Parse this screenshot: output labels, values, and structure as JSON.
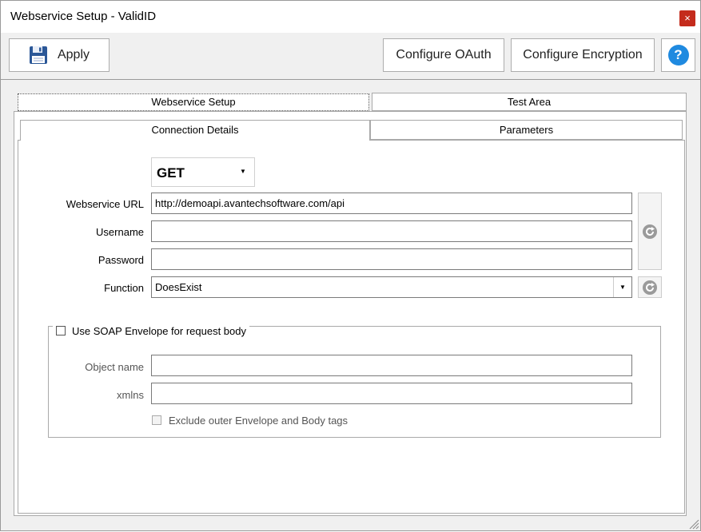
{
  "window": {
    "title": "Webservice Setup - ValidID",
    "close_glyph": "×"
  },
  "toolbar": {
    "apply_label": "Apply",
    "oauth_label": "Configure OAuth",
    "encryption_label": "Configure Encryption",
    "help_glyph": "?"
  },
  "tabs": [
    {
      "label": "Webservice Setup",
      "selected": true
    },
    {
      "label": "Test Area",
      "selected": false
    }
  ],
  "subtabs": [
    {
      "label": "Connection Details",
      "selected": true
    },
    {
      "label": "Parameters",
      "selected": false
    }
  ],
  "form": {
    "method": "GET",
    "url_label": "Webservice URL",
    "url_value": "http://demoapi.avantechsoftware.com/api",
    "username_label": "Username",
    "username_value": "",
    "password_label": "Password",
    "password_value": "",
    "function_label": "Function",
    "function_value": "DoesExist"
  },
  "soap": {
    "checkbox_label": "Use SOAP Envelope for request body",
    "checked": false,
    "object_name_label": "Object name",
    "object_name_value": "",
    "xmlns_label": "xmlns",
    "xmlns_value": "",
    "exclude_label": "Exclude outer Envelope and Body tags",
    "exclude_checked": false
  },
  "colors": {
    "accent": "#1f8ae0",
    "close": "#c42b1c",
    "save_icon": "#2b5797"
  }
}
